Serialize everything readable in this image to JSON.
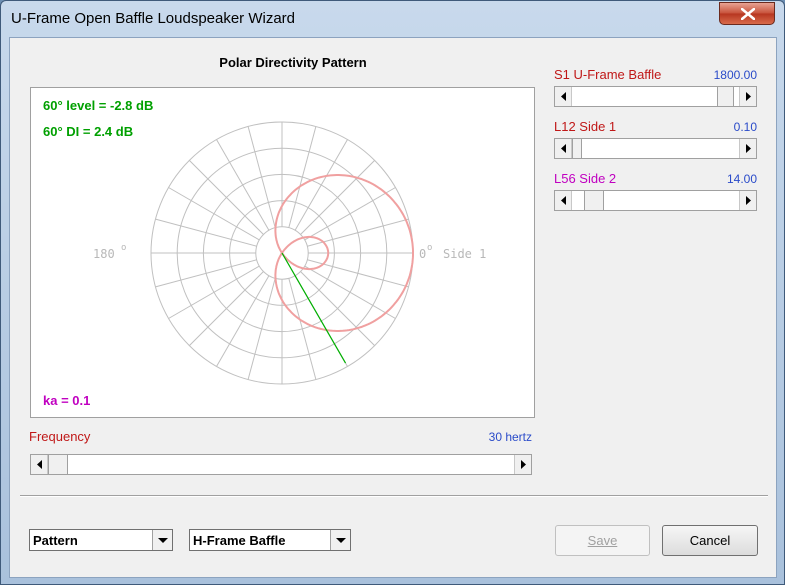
{
  "window": {
    "title": "U-Frame Open Baffle Loudspeaker Wizard"
  },
  "plot": {
    "title": "Polar Directivity Pattern",
    "level_text": "60° level = -2.8 dB",
    "di_text": "60° DI = 2.4 dB",
    "ka_text": "ka = 0.1",
    "left_label": "180",
    "right_label": "0",
    "right_suffix": "Side 1",
    "degree_mark": "o",
    "colors": {
      "level": "#00a000",
      "ka": "#c000c0",
      "pattern": "#f0a0a0",
      "angle_line": "#00b000",
      "grid": "#c0c0c0"
    }
  },
  "sliders": {
    "s1": {
      "label": "S1  U-Frame Baffle",
      "value": "1800.00",
      "color": "#c01818",
      "position": 0.93
    },
    "l12": {
      "label": "L12  Side 1",
      "value": "0.10",
      "color": "#c01818",
      "position": 0.0
    },
    "l56": {
      "label": "L56  Side 2",
      "value": "14.00",
      "color": "#c000c0",
      "position": 0.1
    }
  },
  "frequency": {
    "label": "Frequency",
    "value": "30 hertz",
    "color": "#c01818",
    "position": 0.0
  },
  "bottom": {
    "view_select": "Pattern",
    "baffle_select": "H-Frame Baffle",
    "save_label": "Save",
    "cancel_label": "Cancel"
  }
}
